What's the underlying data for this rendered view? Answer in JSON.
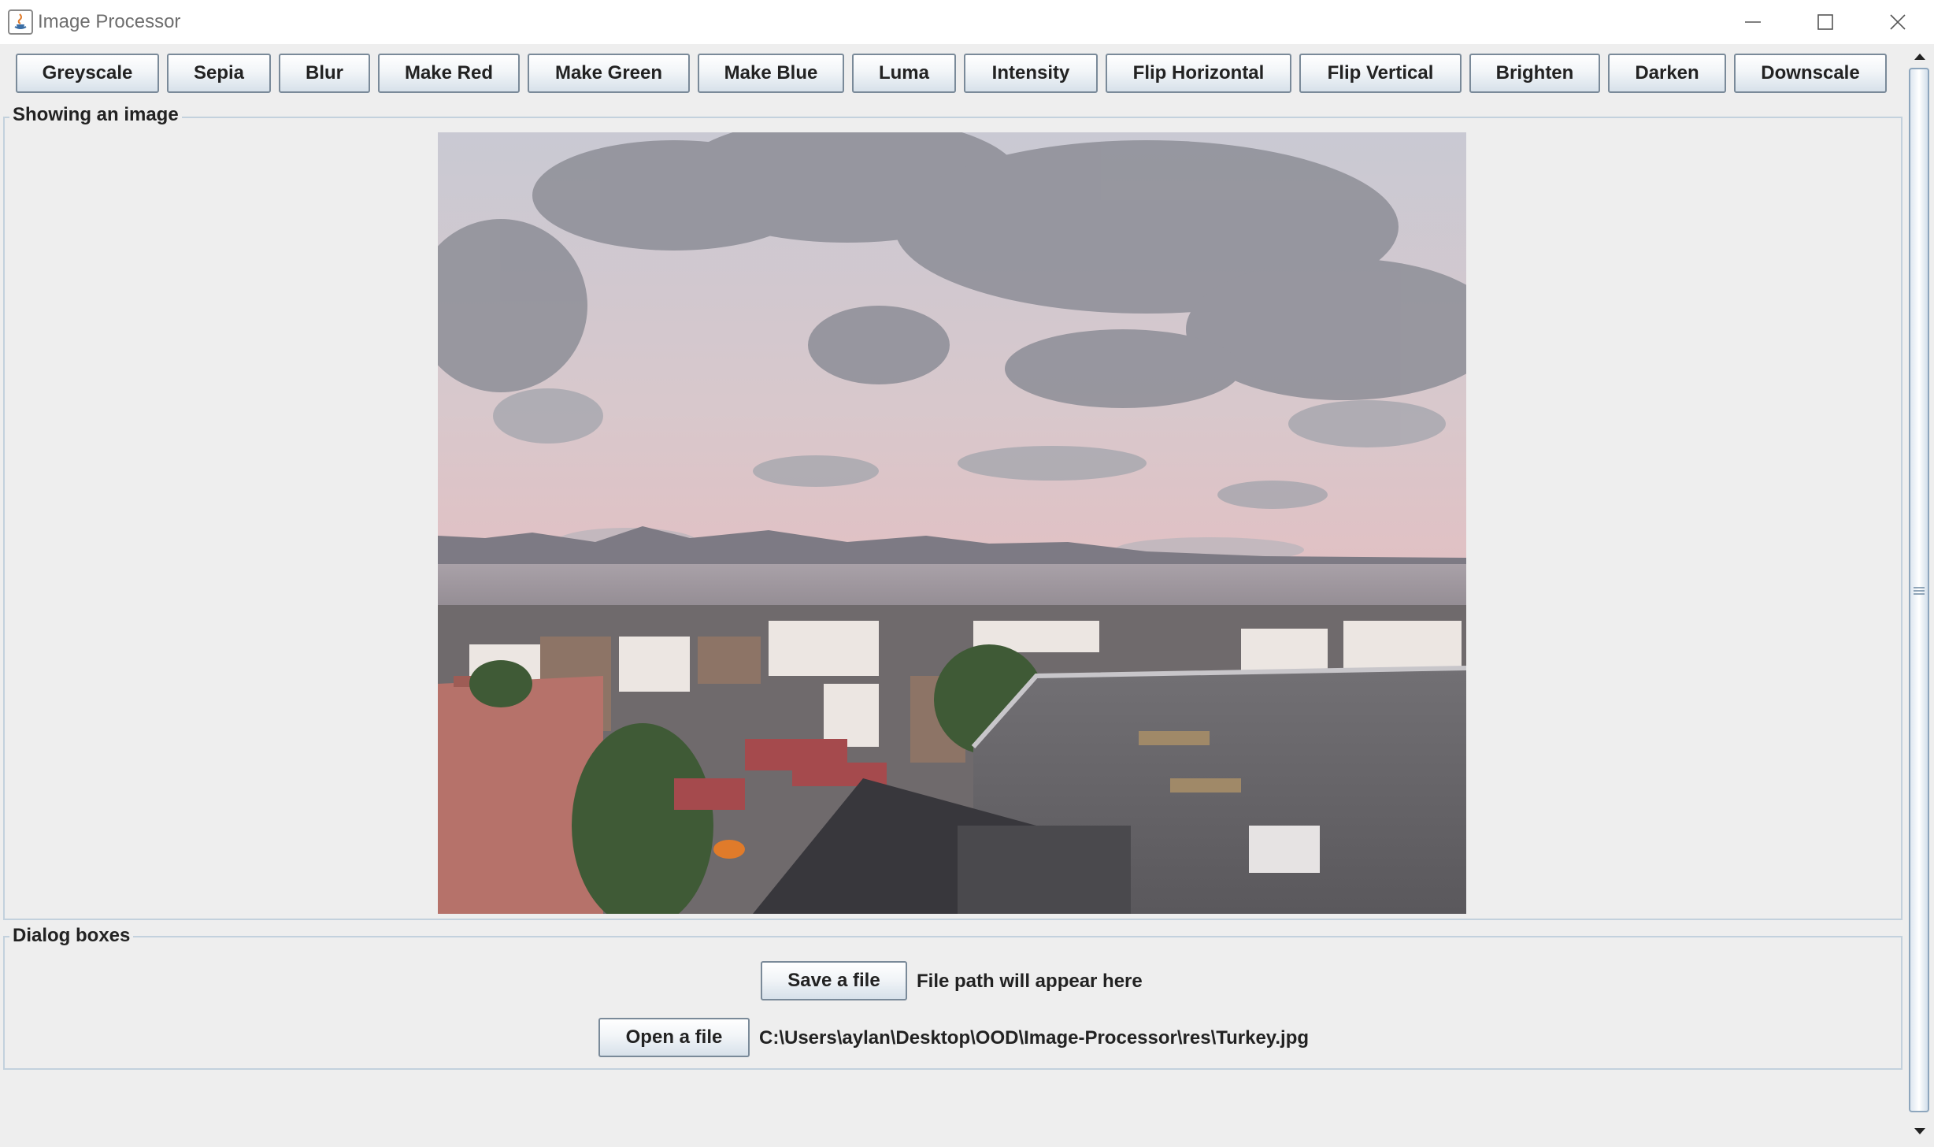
{
  "window": {
    "title": "Image Processor"
  },
  "toolbar": {
    "buttons": [
      {
        "label": "Greyscale"
      },
      {
        "label": "Sepia"
      },
      {
        "label": "Blur"
      },
      {
        "label": "Make Red"
      },
      {
        "label": "Make Green"
      },
      {
        "label": "Make Blue"
      },
      {
        "label": "Luma"
      },
      {
        "label": "Intensity"
      },
      {
        "label": "Flip Horizontal"
      },
      {
        "label": "Flip Vertical"
      },
      {
        "label": "Brighten"
      },
      {
        "label": "Darken"
      },
      {
        "label": "Downscale"
      }
    ]
  },
  "image_panel": {
    "title": "Showing an image"
  },
  "dialog_panel": {
    "title": "Dialog boxes",
    "save_button": "Save a file",
    "save_path": "File path will appear here",
    "open_button": "Open a file",
    "open_path": "C:\\Users\\aylan\\Desktop\\OOD\\Image-Processor\\res\\Turkey.jpg"
  },
  "colors": {
    "window_bg": "#eeeeee",
    "panel_border": "#c3d1dd",
    "button_border": "#7a8a99",
    "scroll_accent": "#8ea6bd"
  }
}
